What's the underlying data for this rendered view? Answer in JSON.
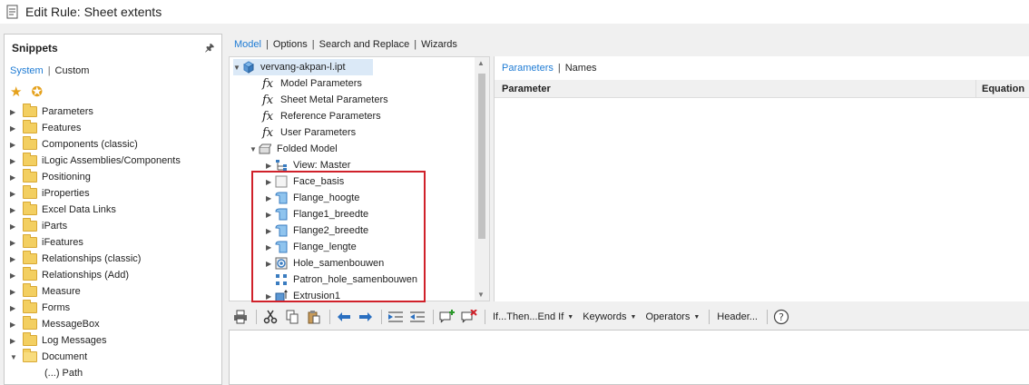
{
  "window": {
    "title": "Edit Rule: Sheet extents"
  },
  "snippets": {
    "title": "Snippets",
    "tabs": [
      "System",
      "Custom"
    ],
    "items": [
      "Parameters",
      "Features",
      "Components (classic)",
      "iLogic Assemblies/Components",
      "Positioning",
      "iProperties",
      "Excel Data Links",
      "iParts",
      "iFeatures",
      "Relationships (classic)",
      "Relationships (Add)",
      "Measure",
      "Forms",
      "MessageBox",
      "Log Messages",
      "Document"
    ],
    "sub_item": "(...) Path"
  },
  "tabs": [
    "Model",
    "Options",
    "Search and Replace",
    "Wizards"
  ],
  "model_tree": {
    "root": "vervang-akpan-l.ipt",
    "params": [
      "Model Parameters",
      "Sheet Metal Parameters",
      "Reference Parameters",
      "User Parameters"
    ],
    "folded": "Folded Model",
    "view": "View: Master",
    "features": [
      "Face_basis",
      "Flange_hoogte",
      "Flange1_breedte",
      "Flange2_breedte",
      "Flange_lengte",
      "Hole_samenbouwen",
      "Patron_hole_samenbouwen",
      "Extrusion1"
    ]
  },
  "params_panel": {
    "tabs": [
      "Parameters",
      "Names"
    ],
    "columns": [
      "Parameter",
      "Equation"
    ]
  },
  "toolbar": {
    "if_then": "If...Then...End If",
    "keywords": "Keywords",
    "operators": "Operators",
    "header": "Header..."
  },
  "colors": {
    "accent": "#1e7bd4",
    "highlight": "#d0212a"
  }
}
